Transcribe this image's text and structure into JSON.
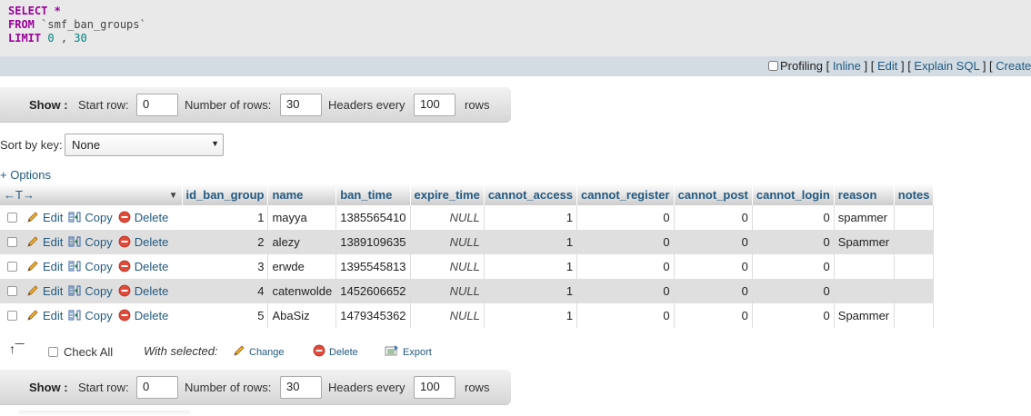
{
  "sql": {
    "select_kw": "SELECT",
    "star": "*",
    "from_kw": "FROM",
    "table": "`smf_ban_groups`",
    "limit_kw": "LIMIT",
    "offset": "0",
    "comma": ",",
    "count": "30"
  },
  "tools": {
    "profiling": "Profiling",
    "inline": "Inline",
    "edit": "Edit",
    "explain": "Explain SQL",
    "create": "Create"
  },
  "nav": {
    "show": "Show :",
    "start_row_label": "Start row:",
    "start_row_value": "0",
    "num_rows_label": "Number of rows:",
    "num_rows_value": "30",
    "headers_label": "Headers every",
    "headers_value": "100",
    "rows_label": "rows"
  },
  "sort": {
    "label": "Sort by key:",
    "selected": "None"
  },
  "options_link": "+ Options",
  "table": {
    "columns": [
      "id_ban_group",
      "name",
      "ban_time",
      "expire_time",
      "cannot_access",
      "cannot_register",
      "cannot_post",
      "cannot_login",
      "reason",
      "notes"
    ],
    "actions": {
      "edit": "Edit",
      "copy": "Copy",
      "delete": "Delete"
    },
    "rows": [
      [
        "1",
        "mayya",
        "1385565410",
        "NULL",
        "1",
        "0",
        "0",
        "0",
        "spammer",
        ""
      ],
      [
        "2",
        "alezy",
        "1389109635",
        "NULL",
        "1",
        "0",
        "0",
        "0",
        "Spammer",
        ""
      ],
      [
        "3",
        "erwde",
        "1395545813",
        "NULL",
        "1",
        "0",
        "0",
        "0",
        "",
        ""
      ],
      [
        "4",
        "catenwolde",
        "1452606652",
        "NULL",
        "1",
        "0",
        "0",
        "0",
        "",
        ""
      ],
      [
        "5",
        "AbaSiz",
        "1479345362",
        "NULL",
        "1",
        "0",
        "0",
        "0",
        "Spammer",
        ""
      ]
    ]
  },
  "bulk": {
    "check_all": "Check All",
    "with_selected": "With selected:",
    "change": "Change",
    "delete": "Delete",
    "export": "Export"
  }
}
